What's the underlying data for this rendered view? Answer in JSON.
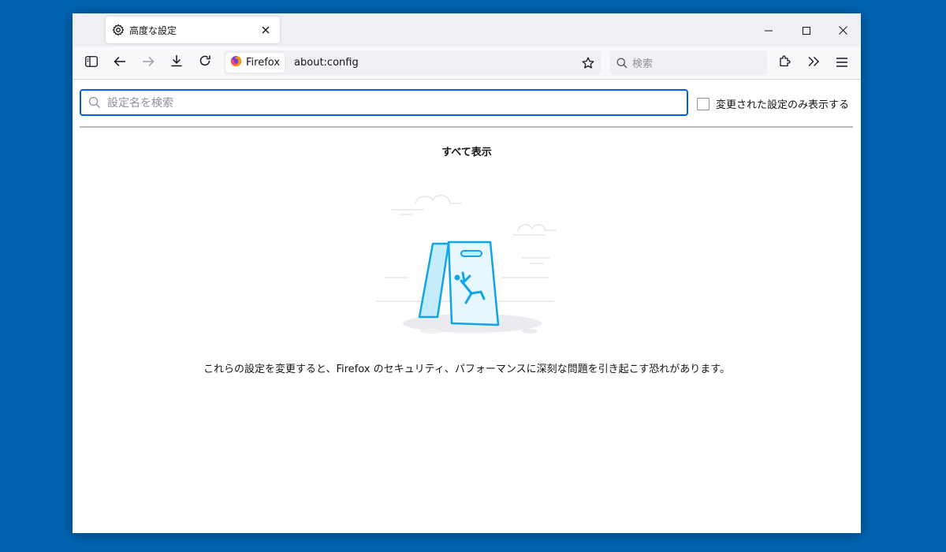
{
  "tab": {
    "title": "高度な設定",
    "icon": "gear-icon"
  },
  "window_controls": {
    "minimize": "minimize-icon",
    "maximize": "maximize-icon",
    "close": "close-icon"
  },
  "toolbar": {
    "identity_label": "Firefox",
    "url": "about:config",
    "search_placeholder": "検索"
  },
  "config": {
    "filter_placeholder": "設定名を検索",
    "modified_only_label": "変更された設定のみ表示する",
    "show_all": "すべて表示",
    "warning_text": "これらの設定を変更すると、Firefox のセキュリティ、パフォーマンスに深刻な問題を引き起こす恐れがあります。"
  },
  "colors": {
    "desktop": "#0063b1",
    "focus_ring": "#0061e0",
    "illustration": "#0ea5e9"
  }
}
